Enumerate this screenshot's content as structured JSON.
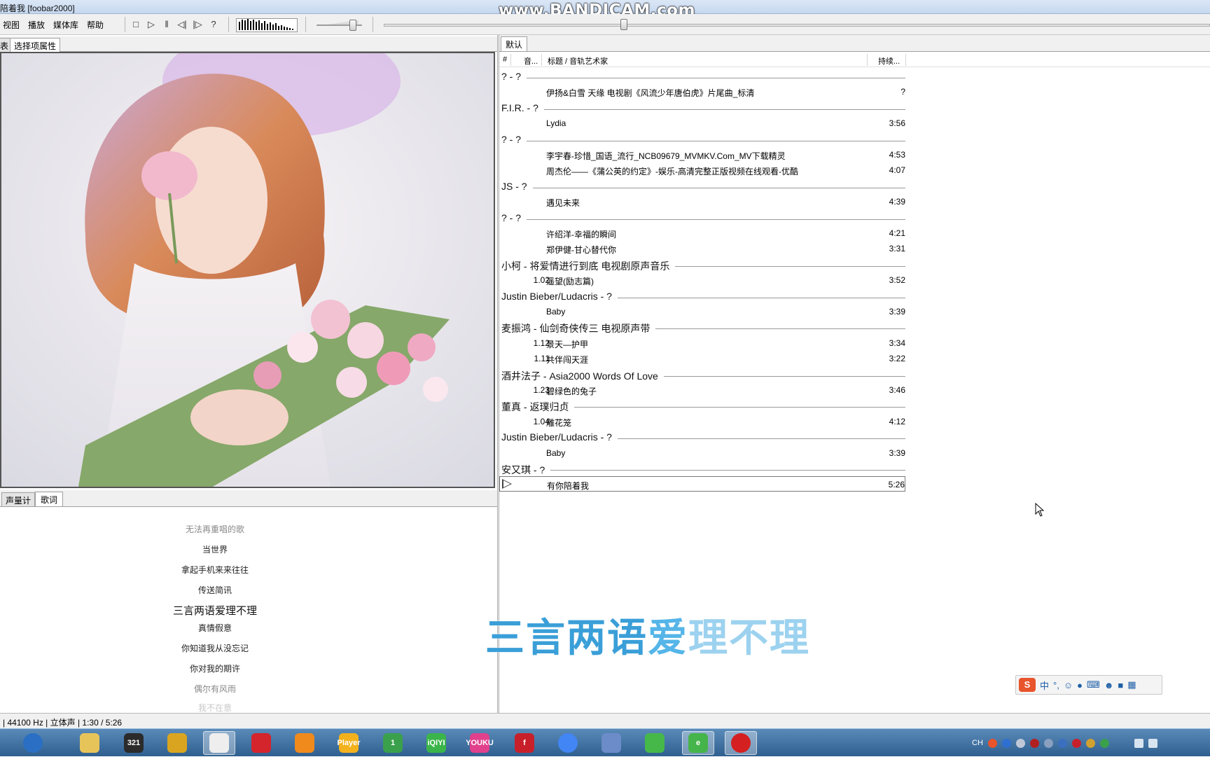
{
  "window": {
    "title": "陪着我  [foobar2000]",
    "watermark": "www.BANDICAM.com"
  },
  "menu": {
    "items": [
      "视图",
      "播放",
      "媒体库",
      "帮助"
    ]
  },
  "toolbar": {
    "buttons": [
      "stop-icon",
      "play-icon",
      "pause-icon",
      "previous-icon",
      "next-icon",
      "random-icon"
    ],
    "volume_level": 0.8,
    "seek_position": 0.29
  },
  "left_tabs": {
    "partial": "表",
    "properties": "选择项属性"
  },
  "lower_tabs": {
    "meter": "声量计",
    "lyrics": "歌词"
  },
  "lyrics": {
    "lines": [
      {
        "text": "",
        "style": "faint"
      },
      {
        "text": "无法再重唱的歌",
        "style": "dim"
      },
      {
        "text": "当世界",
        "style": "normal"
      },
      {
        "text": "拿起手机来来往往",
        "style": "normal"
      },
      {
        "text": "传送简讯",
        "style": "normal"
      },
      {
        "text": "三言两语爱理不理",
        "style": "current"
      },
      {
        "text": "真情假意",
        "style": "normal"
      },
      {
        "text": "你知道我从没忘记",
        "style": "normal"
      },
      {
        "text": "你对我的期许",
        "style": "normal"
      },
      {
        "text": "偶尔有风雨",
        "style": "dim"
      },
      {
        "text": "我不在意",
        "style": "faint"
      }
    ]
  },
  "desktop_lyric": {
    "part1": "三言两语",
    "part2": "爱",
    "part3": "理不理"
  },
  "playlist": {
    "tab": "默认",
    "headers": {
      "num": "#",
      "track": "音...",
      "title": "标题 / 音轨艺术家",
      "duration": "持续..."
    },
    "rows": [
      {
        "type": "group",
        "title": "? - ?"
      },
      {
        "type": "track",
        "num": "",
        "title": "伊扬&白雪 天缘 电视剧《风流少年唐伯虎》片尾曲_标清",
        "duration": "?"
      },
      {
        "type": "group",
        "title": "F.I.R. - ?"
      },
      {
        "type": "track",
        "num": "",
        "title": "Lydia",
        "duration": "3:56"
      },
      {
        "type": "group",
        "title": "? - ?"
      },
      {
        "type": "track",
        "num": "",
        "title": "李宇春-珍惜_国语_流行_NCB09679_MVMKV.Com_MV下载精灵",
        "duration": "4:53"
      },
      {
        "type": "track",
        "num": "",
        "title": "周杰伦——《蒲公英的约定》-娱乐-高清完整正版视频在线观看-优酷",
        "duration": "4:07"
      },
      {
        "type": "group",
        "title": "JS - ?"
      },
      {
        "type": "track",
        "num": "",
        "title": "遇见未来",
        "duration": "4:39"
      },
      {
        "type": "group",
        "title": "? - ?"
      },
      {
        "type": "track",
        "num": "",
        "title": "许绍洋-幸福的瞬间",
        "duration": "4:21"
      },
      {
        "type": "track",
        "num": "",
        "title": "郑伊健-甘心替代你",
        "duration": "3:31"
      },
      {
        "type": "group",
        "title": "小柯 - 将爱情进行到底 电视剧原声音乐"
      },
      {
        "type": "track",
        "num": "1.02",
        "title": "遥望(励志篇)",
        "duration": "3:52"
      },
      {
        "type": "group",
        "title": "Justin Bieber/Ludacris - ?"
      },
      {
        "type": "track",
        "num": "",
        "title": "Baby",
        "duration": "3:39"
      },
      {
        "type": "group",
        "title": "麦振鸿 - 仙剑奇侠传三 电视原声带"
      },
      {
        "type": "track",
        "num": "1.12",
        "title": "景天—护甲",
        "duration": "3:34"
      },
      {
        "type": "track",
        "num": "1.11",
        "title": "共伴闯天涯",
        "duration": "3:22"
      },
      {
        "type": "group",
        "title": "酒井法子 - Asia2000 Words Of Love"
      },
      {
        "type": "track",
        "num": "1.23",
        "title": "碧绿色的兔子",
        "duration": "3:46"
      },
      {
        "type": "group",
        "title": "董真 - 返璞归贞"
      },
      {
        "type": "track",
        "num": "1.04",
        "title": "雕花笼",
        "duration": "4:12"
      },
      {
        "type": "group",
        "title": "Justin Bieber/Ludacris - ?"
      },
      {
        "type": "track",
        "num": "",
        "title": "Baby",
        "duration": "3:39"
      },
      {
        "type": "group",
        "title": "安又琪 - ?"
      },
      {
        "type": "track",
        "num": "",
        "title": "有你陪着我",
        "duration": "5:26",
        "playing": true
      }
    ]
  },
  "ime": {
    "label": "中",
    "punct": "°,"
  },
  "status": {
    "text": "| 44100 Hz | 立体声 | 1:30 / 5:26"
  },
  "taskbar": {
    "apps": [
      {
        "name": "start-orb-icon",
        "label": "",
        "color": "#2a6fc4"
      },
      {
        "name": "file-explorer-icon",
        "label": "",
        "color": "#e7c45a"
      },
      {
        "name": "media-321-icon",
        "label": "321",
        "color": "#2b2b2b"
      },
      {
        "name": "headphones-icon",
        "label": "",
        "color": "#d9a520"
      },
      {
        "name": "foobar-alien-icon",
        "label": "",
        "color": "#eeeeee"
      },
      {
        "name": "netease-music-icon",
        "label": "",
        "color": "#d4242c"
      },
      {
        "name": "player-disc-icon",
        "label": "",
        "color": "#f08a1c"
      },
      {
        "name": "kmplayer-icon",
        "label": "Player",
        "color": "#f3b21d"
      },
      {
        "name": "360-icon",
        "label": "1",
        "color": "#3aa04c"
      },
      {
        "name": "iqiyi-icon",
        "label": "iQIYI",
        "color": "#3bb54a"
      },
      {
        "name": "youku-icon",
        "label": "YOUKU",
        "color": "#e1408c"
      },
      {
        "name": "flash-icon",
        "label": "f",
        "color": "#c8202a"
      },
      {
        "name": "chrome-icon",
        "label": "",
        "color": "#4285f4"
      },
      {
        "name": "bird-app-icon",
        "label": "",
        "color": "#6b8cc9"
      },
      {
        "name": "play-green-icon",
        "label": "",
        "color": "#46b84a"
      },
      {
        "name": "ie-browser-icon",
        "label": "e",
        "color": "#45b44a"
      },
      {
        "name": "bandicam-record-icon",
        "label": "",
        "color": "#d42020"
      }
    ],
    "tray_label": "CH"
  }
}
